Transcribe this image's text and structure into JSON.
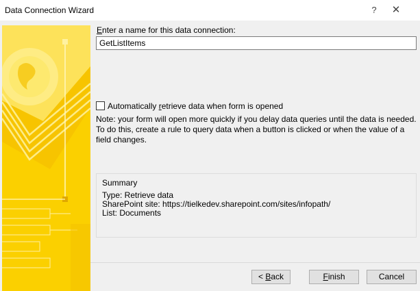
{
  "window": {
    "title": "Data Connection Wizard",
    "help_glyph": "?",
    "close_glyph": "✕"
  },
  "form": {
    "name_label_accel": "E",
    "name_label_rest": "nter a name for this data connection:",
    "name_value": "GetListItems",
    "auto_checkbox": {
      "checked": false,
      "label_before": "Automatically ",
      "label_accel": "r",
      "label_after": "etrieve data when form is opened"
    },
    "note": "Note: your form will open more quickly if you delay data queries until the data is needed. To do this, create a rule to query data when a button is clicked or when the value of a field changes."
  },
  "summary": {
    "heading": "Summary",
    "type_line": "Type: Retrieve data",
    "site_line": "SharePoint site: https://tielkedev.sharepoint.com/sites/infopath/",
    "list_line": "List: Documents"
  },
  "buttons": {
    "back_prefix": "< ",
    "back_accel": "B",
    "back_rest": "ack",
    "finish_accel": "F",
    "finish_rest": "inish",
    "cancel_label": "Cancel"
  },
  "colors": {
    "art_yellow": "#fbd000",
    "art_light": "#fde96a",
    "art_dark": "#f2b800"
  }
}
